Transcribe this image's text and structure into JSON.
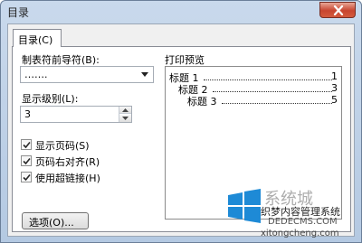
{
  "window": {
    "title": "目录"
  },
  "tab": {
    "label": "目录(C)"
  },
  "leader": {
    "label": "制表符前导符(B):",
    "value": "……."
  },
  "levels": {
    "label": "显示级别(L):",
    "value": "3"
  },
  "checkboxes": [
    {
      "label": "显示页码(S)",
      "checked": true
    },
    {
      "label": "页码右对齐(R)",
      "checked": true
    },
    {
      "label": "使用超链接(H)",
      "checked": true
    }
  ],
  "options_button": {
    "label": "选项(O)..."
  },
  "preview": {
    "label": "打印预览",
    "entries": [
      {
        "text": "标题 1",
        "page": "1"
      },
      {
        "text": "标题 2",
        "page": "3"
      },
      {
        "text": "标题 3",
        "page": "5"
      }
    ]
  },
  "watermark": {
    "brand": "系统城",
    "site": "织梦内容管理系统",
    "url1": "DEDECMS.COM",
    "url2": "xitongcheng.com"
  },
  "colors": {
    "titlebar": "#c9d9ec",
    "close": "#c8452f",
    "panel": "#ffffff",
    "watermark_logo": "#1e8ad6"
  }
}
